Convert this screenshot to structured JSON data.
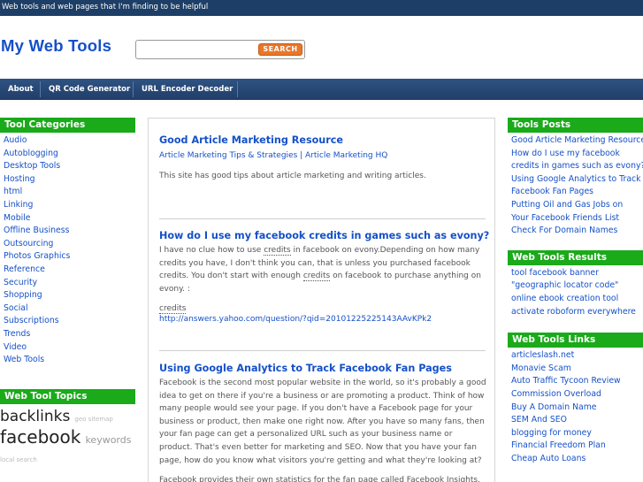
{
  "topbar": {
    "tagline": "Web tools and web pages that I'm finding to be helpful"
  },
  "header": {
    "site_title": "My Web Tools",
    "search_placeholder": "",
    "search_button": "SEARCH"
  },
  "nav": {
    "items": [
      "About",
      "QR Code Generator",
      "URL Encoder Decoder"
    ]
  },
  "left": {
    "categories_title": "Tool Categories",
    "categories": [
      "Audio",
      "Autoblogging",
      "Desktop Tools",
      "Hosting",
      "html",
      "Linking",
      "Mobile",
      "Offline Business",
      "Outsourcing",
      "Photos Graphics",
      "Reference",
      "Security",
      "Shopping",
      "Social",
      "Subscriptions",
      "Trends",
      "Video",
      "Web Tools"
    ],
    "topics_title": "Web Tool Topics",
    "tags": {
      "t1": "backlinks",
      "t2": "geo sitemap",
      "t3": "facebook",
      "t4": "keywords",
      "t5": "local search"
    }
  },
  "posts": [
    {
      "title": "Good Article Marketing Resource",
      "sub": "Article Marketing Tips & Strategies | Article Marketing HQ",
      "body": "This site has good tips about article marketing and writing articles."
    },
    {
      "title": "How do I use my facebook credits in games such as evony?",
      "body_a": "I have no clue how to use ",
      "body_b": "credits",
      "body_c": " in facebook on evony.Depending on how many credits you have, I don't think you can, that is unless you purchased facebook credits. You don't start with enough ",
      "body_d": "credits",
      "body_e": " on facebook to purchase anything on evony. :",
      "tag": "credits",
      "link": "http://answers.yahoo.com/question/?qid=20101225225143AAvKPk2"
    },
    {
      "title": "Using Google Analytics to Track Facebook Fan Pages",
      "body": "Facebook is the second most popular website in the world, so it's probably a good idea to get on there if you're a business or are promoting a product. Think of how many people would see your page. If you don't have a Facebook page for your business or product, then make one right now. After you have so many fans, then your fan page can get a personalized URL such as your business name or product. That's even better for marketing and SEO. Now that you have your fan page, how do you know what visitors you're getting and what they're looking at?",
      "trailing": "Facebook provides their own statistics for the fan page called Facebook Insights. It"
    }
  ],
  "right": {
    "posts_title": "Tools Posts",
    "posts": [
      "Good Article Marketing Resource",
      "How do I use my facebook",
      "credits in games such as evony?",
      "Using Google Analytics to Track",
      "Facebook Fan Pages",
      "Putting Oil and Gas Jobs on",
      "Your Facebook Friends List",
      "Check For Domain Names"
    ],
    "results_title": "Web Tools Results",
    "results": [
      "tool facebook banner",
      "\"geographic locator code\"",
      "online ebook creation tool",
      "activate roboform everywhere"
    ],
    "links_title": "Web Tools Links",
    "links": [
      "articleslash.net",
      "Monavie Scam",
      "Auto Traffic Tycoon Review",
      "Commission Overload",
      "Buy A Domain Name",
      "SEM And SEO",
      "blogging for money",
      "Financial Freedom Plan",
      "Cheap Auto Loans"
    ]
  }
}
